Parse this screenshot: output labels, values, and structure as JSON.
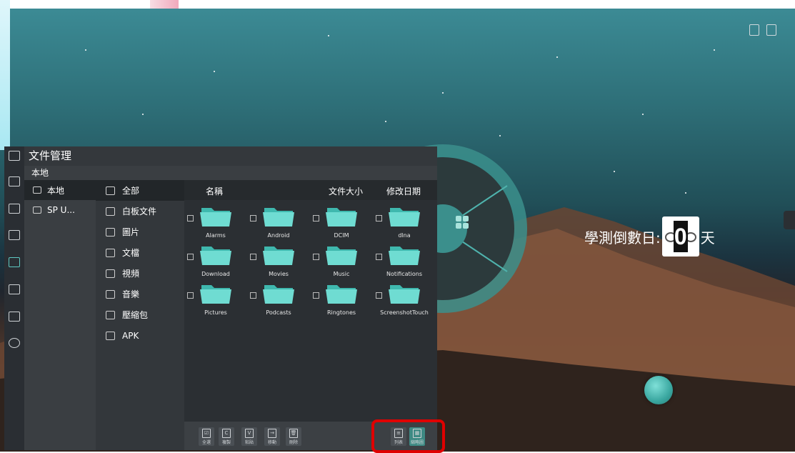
{
  "status_icons": [
    "usb-icon",
    "monitor-icon"
  ],
  "countdown": {
    "label": "學測倒數日:",
    "value": "0",
    "unit": "天"
  },
  "sidebar_icons": [
    "brand-icon",
    "back-icon",
    "home-icon",
    "settings-icon",
    "folder-icon",
    "storage-icon",
    "keyboard-icon",
    "power-icon"
  ],
  "file_manager": {
    "title": "文件管理",
    "location": "本地",
    "nav": [
      {
        "label": "本地",
        "icon": "monitor-icon"
      },
      {
        "label": "SP U...",
        "icon": "usb-icon"
      }
    ],
    "categories": [
      {
        "label": "全部",
        "icon": "all-icon"
      },
      {
        "label": "白板文件",
        "icon": "whiteboard-icon"
      },
      {
        "label": "圖片",
        "icon": "image-icon"
      },
      {
        "label": "文檔",
        "icon": "document-icon"
      },
      {
        "label": "視頻",
        "icon": "video-icon"
      },
      {
        "label": "音樂",
        "icon": "music-icon"
      },
      {
        "label": "壓縮包",
        "icon": "archive-icon"
      },
      {
        "label": "APK",
        "icon": "apk-icon"
      }
    ],
    "columns": {
      "name": "名稱",
      "size": "文件大小",
      "modified": "修改日期"
    },
    "folders": [
      "Alarms",
      "Android",
      "DCIM",
      "dlna",
      "Download",
      "Movies",
      "Music",
      "Notifications",
      "Pictures",
      "Podcasts",
      "Ringtones",
      "ScreenshotTouch"
    ],
    "toolbar": [
      {
        "label": "全選",
        "glyph": "☑"
      },
      {
        "label": "複製",
        "glyph": "C"
      },
      {
        "label": "粘貼",
        "glyph": "V"
      },
      {
        "label": "移動",
        "glyph": "→"
      },
      {
        "label": "刪除",
        "glyph": "🗑"
      }
    ],
    "view_modes": [
      {
        "label": "列表",
        "glyph": "≡"
      },
      {
        "label": "縮略圖",
        "glyph": "▦"
      }
    ]
  },
  "colors": {
    "accent": "#5ec9c2",
    "highlight": "#e00000"
  }
}
